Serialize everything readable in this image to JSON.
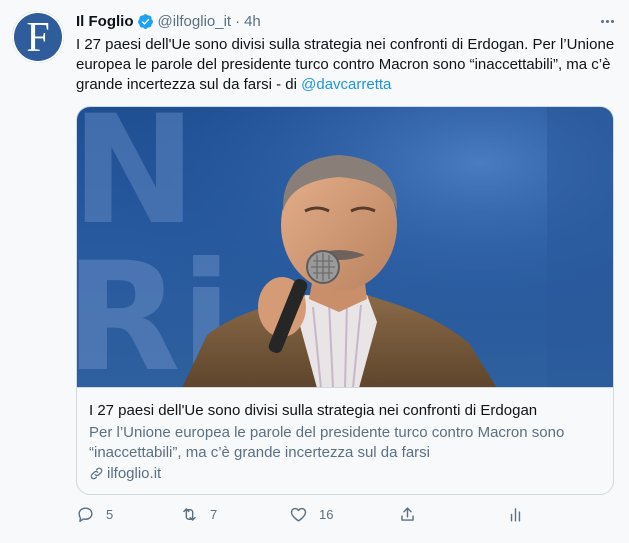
{
  "account": {
    "name": "Il Foglio",
    "handle": "@ilfoglio_it",
    "separator": "·",
    "time": "4h",
    "avatar_letter": "F",
    "avatar_color": "#2f5c9a",
    "verified_icon": "verified-badge-icon"
  },
  "tweet": {
    "text_before_mention": "I 27 paesi dell'Ue sono divisi sulla strategia nei confronti di Erdogan. Per l’Unione europea le parole del presidente turco contro Macron sono “inaccettabili”, ma c’è grande incertezza sul da farsi - di ",
    "mention": "@davcarretta"
  },
  "card": {
    "title": "I 27 paesi dell'Ue sono divisi sulla strategia nei confronti di Erdogan",
    "description": "Per l’Unione europea le parole del presidente turco contro Macron sono “inaccettabili”, ma c’è grande incertezza sul da farsi",
    "domain": "ilfoglio.it",
    "image_background_letters": "N Ri"
  },
  "actions": {
    "replies": "5",
    "retweets": "7",
    "likes": "16",
    "share_icon": "share-icon",
    "analytics_icon": "analytics-icon"
  },
  "colors": {
    "accent": "#1b95e0",
    "muted": "#5b7083",
    "background": "#f7f9fa",
    "border": "#cfd9de"
  }
}
